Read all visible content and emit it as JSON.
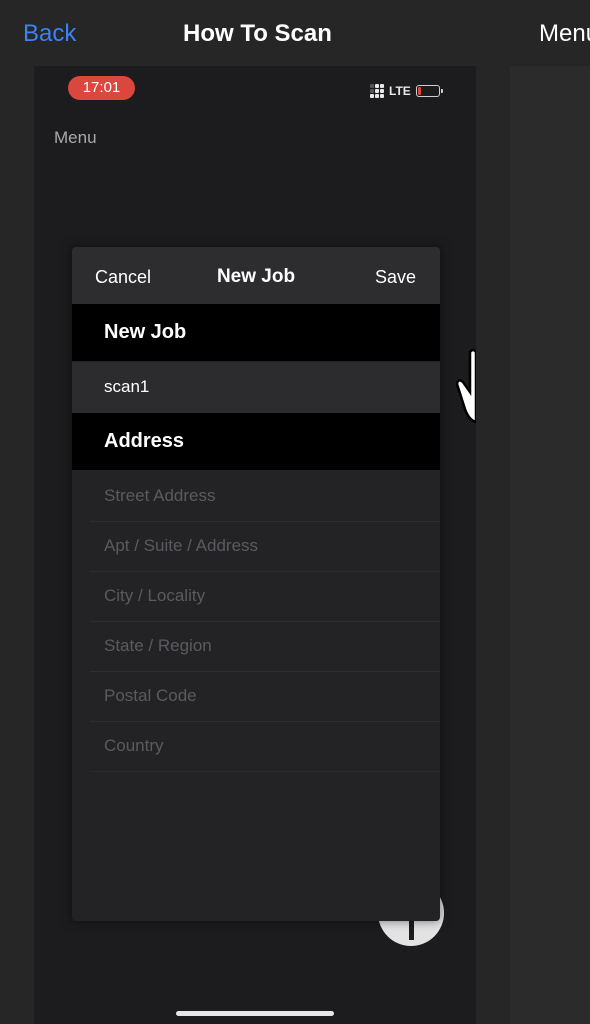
{
  "nav": {
    "back_label": "Back",
    "title": "How To Scan",
    "menu_label": "Menu"
  },
  "phone": {
    "status": {
      "time": "17:01",
      "network": "LTE"
    },
    "menu_label": "Menu"
  },
  "modal": {
    "cancel_label": "Cancel",
    "title": "New Job",
    "save_label": "Save",
    "job_section_label": "New Job",
    "job_name_value": "scan1",
    "address_section_label": "Address",
    "fields": {
      "street": {
        "placeholder": "Street Address"
      },
      "apt": {
        "placeholder": "Apt / Suite / Address"
      },
      "city": {
        "placeholder": "City / Locality"
      },
      "state": {
        "placeholder": "State / Region"
      },
      "postal": {
        "placeholder": "Postal Code"
      },
      "country": {
        "placeholder": "Country"
      }
    }
  },
  "colors": {
    "accent": "#3a82f7",
    "time_badge": "#d9473d",
    "background": "#262626"
  }
}
